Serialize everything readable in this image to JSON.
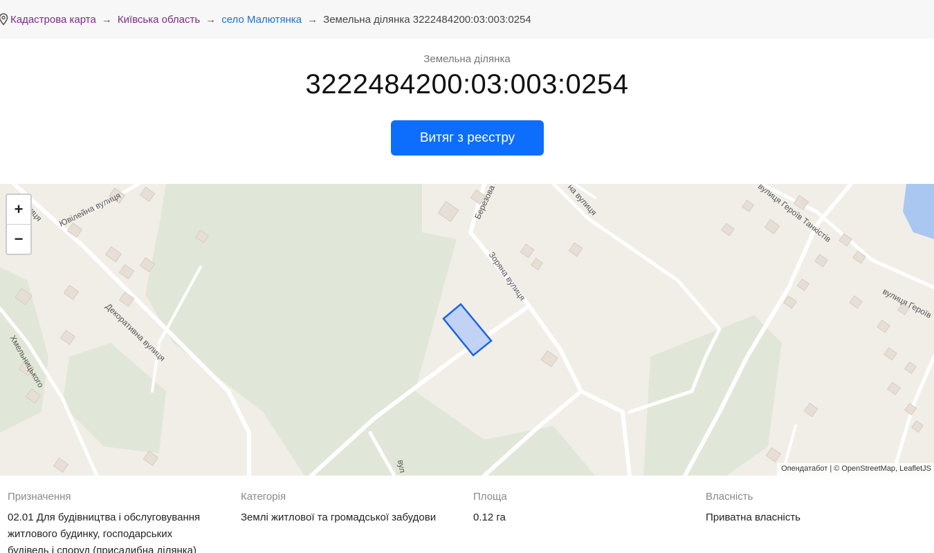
{
  "breadcrumb": {
    "items": [
      {
        "label": "Кадастрова карта"
      },
      {
        "label": "Київська область"
      },
      {
        "label": "село Малютянка"
      }
    ],
    "separator": "→",
    "current": "Земельна ділянка 3222484200:03:003:0254"
  },
  "parcel": {
    "subtitle": "Земельна ділянка",
    "number": "3222484200:03:003:0254",
    "extract_button_label": "Витяг з реєстру"
  },
  "map": {
    "zoom_in_label": "+",
    "zoom_out_label": "−",
    "attribution": {
      "part1": "Опендатабот",
      "separator": "|",
      "part2": "© OpenStreetMap, LeafletJS"
    },
    "street_labels": {
      "s1": "Ювілейна вулиця",
      "s2": "вулиця",
      "s3": "Декоративна вулиця",
      "s4": "Хмельницького",
      "s5": "Березова вулиця",
      "s6": "Зоряна вулиця",
      "s7": "на вулиця",
      "s8": "вулиця Героїв Танкістів",
      "s9": "вулиця Героїв",
      "s10": "вул"
    },
    "colors": {
      "background": "#f1eee8",
      "green": "#e1e7d8",
      "road": "#ffffff",
      "parcel_fill": "#b9cdf6",
      "parcel_stroke": "#1a63e6",
      "water": "#a9c7f0"
    }
  },
  "info": {
    "purpose": {
      "label": "Призначення",
      "lines": [
        "02.01 Для будівництва і обслуговування",
        "житлового будинку, господарських",
        "будівель і споруд (присадибна ділянка)"
      ]
    },
    "category": {
      "label": "Категорія",
      "value": "Землі житлової та громадської забудови"
    },
    "area": {
      "label": "Площа",
      "value": "0.12 га"
    },
    "ownership": {
      "label": "Власність",
      "value": "Приватна власність"
    }
  },
  "theme": {
    "accent": "#0d6efd",
    "link_purple": "#7b2a86",
    "link_blue": "#1f6fd1"
  }
}
